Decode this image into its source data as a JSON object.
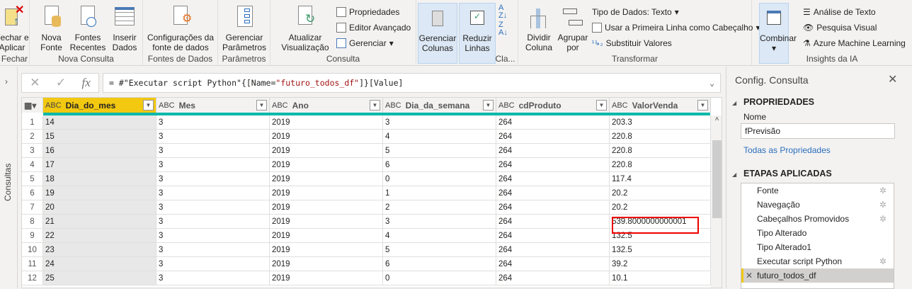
{
  "ribbon": {
    "fechar": {
      "button": "Fechar e Aplicar",
      "group": "Fechar"
    },
    "nova_consulta": {
      "group": "Nova Consulta",
      "nova_fonte": "Nova Fonte",
      "fontes_recentes": "Fontes Recentes",
      "inserir_dados": "Inserir Dados"
    },
    "fontes": {
      "group": "Fontes de Dados",
      "config": "Configurações da fonte de dados"
    },
    "parametros": {
      "group": "Parâmetros",
      "gerenciar": "Gerenciar Parâmetros"
    },
    "consulta": {
      "group": "Consulta",
      "atualizar": "Atualizar Visualização",
      "propriedades": "Propriedades",
      "editor": "Editor Avançado",
      "gerenciar": "Gerenciar"
    },
    "colunas": {
      "gerenciar": "Gerenciar Colunas",
      "reduzir": "Reduzir Linhas",
      "group": "Cla..."
    },
    "transformar": {
      "group": "Transformar",
      "dividir": "Dividir Coluna",
      "agrupar": "Agrupar por",
      "tipo": "Tipo de Dados: Texto",
      "primeira": "Usar a Primeira Linha como Cabeçalho",
      "substituir": "Substituir Valores"
    },
    "insights": {
      "group": "Insights da IA",
      "combinar": "Combinar",
      "texto": "Análise de Texto",
      "visual": "Pesquisa Visual",
      "azure": "Azure Machine Learning"
    }
  },
  "left_pane": {
    "label": "Consultas"
  },
  "formula": {
    "prefix": "= #\"Executar script Python\"{[Name=",
    "string": "\"futuro_todos_df\"",
    "suffix": "]}[Value]",
    "fx": "fx"
  },
  "columns": [
    "Dia_do_mes",
    "Mes",
    "Ano",
    "Dia_da_semana",
    "cdProduto",
    "ValorVenda"
  ],
  "type_label": "ABC",
  "rows": [
    [
      "1",
      "14",
      "3",
      "2019",
      "3",
      "264",
      "203.3"
    ],
    [
      "2",
      "15",
      "3",
      "2019",
      "4",
      "264",
      "220.8"
    ],
    [
      "3",
      "16",
      "3",
      "2019",
      "5",
      "264",
      "220.8"
    ],
    [
      "4",
      "17",
      "3",
      "2019",
      "6",
      "264",
      "220.8"
    ],
    [
      "5",
      "18",
      "3",
      "2019",
      "0",
      "264",
      "117.4"
    ],
    [
      "6",
      "19",
      "3",
      "2019",
      "1",
      "264",
      "20.2"
    ],
    [
      "7",
      "20",
      "3",
      "2019",
      "2",
      "264",
      "20.2"
    ],
    [
      "8",
      "21",
      "3",
      "2019",
      "3",
      "264",
      "539.8000000000001"
    ],
    [
      "9",
      "22",
      "3",
      "2019",
      "4",
      "264",
      "132.5"
    ],
    [
      "10",
      "23",
      "3",
      "2019",
      "5",
      "264",
      "132.5"
    ],
    [
      "11",
      "24",
      "3",
      "2019",
      "6",
      "264",
      "39.2"
    ],
    [
      "12",
      "25",
      "3",
      "2019",
      "0",
      "264",
      "10.1"
    ]
  ],
  "query_settings": {
    "title": "Config. Consulta",
    "properties_header": "PROPRIEDADES",
    "name_label": "Nome",
    "name_value": "fPrevisão",
    "all_props": "Todas as Propriedades",
    "steps_header": "ETAPAS APLICADAS",
    "steps": [
      {
        "label": "Fonte",
        "gear": true
      },
      {
        "label": "Navegação",
        "gear": true
      },
      {
        "label": "Cabeçalhos Promovidos",
        "gear": true
      },
      {
        "label": "Tipo Alterado",
        "gear": false
      },
      {
        "label": "Tipo Alterado1",
        "gear": false
      },
      {
        "label": "Executar script Python",
        "gear": true
      },
      {
        "label": "futuro_todos_df",
        "gear": false
      }
    ]
  },
  "colors": {
    "accent": "#f2c811",
    "teal": "#01b8aa",
    "highlight": "#e00000"
  }
}
